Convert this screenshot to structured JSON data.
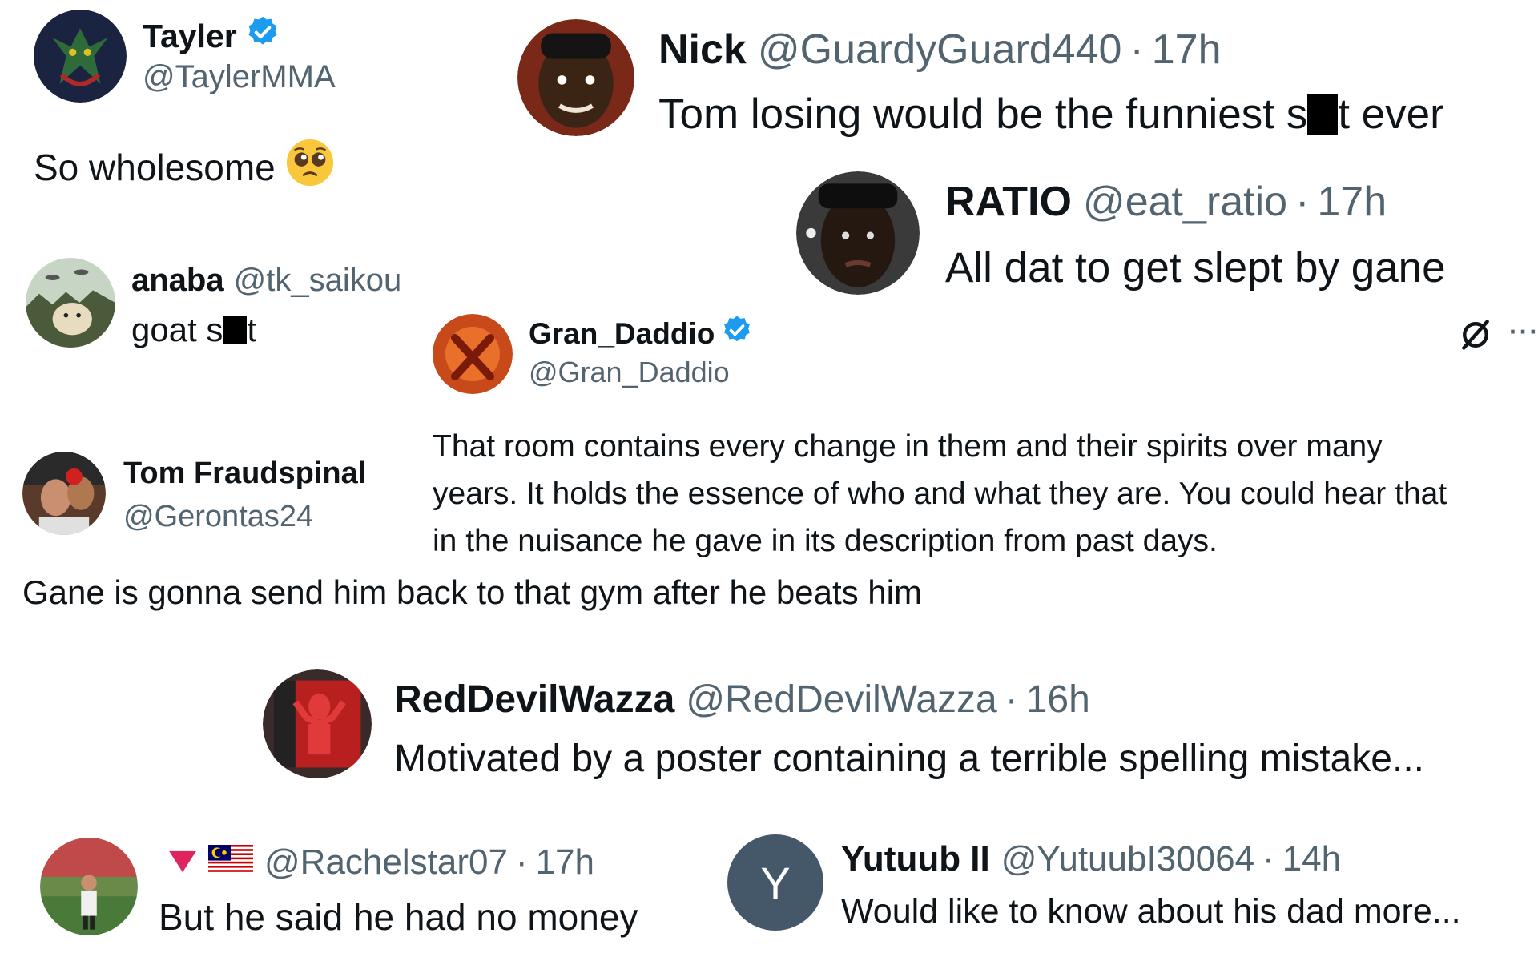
{
  "colors": {
    "text": "#0f1419",
    "muted": "#536471",
    "verified": "#1d9bf0",
    "letter_avatar_bg": "#44586a"
  },
  "tweets": [
    {
      "id": "tayler",
      "name": "Tayler",
      "verified": true,
      "handle": "@TaylerMMA",
      "text": "So wholesome",
      "emoji_icon": "pleading-face-icon"
    },
    {
      "id": "nick",
      "name": "Nick",
      "handle": "@GuardyGuard440",
      "sep": "·",
      "time": "17h",
      "text_before": "Tom losing would be the funniest s",
      "text_after": "t ever"
    },
    {
      "id": "ratio",
      "name": "RATIO",
      "handle": "@eat_ratio",
      "sep": "·",
      "time": "17h",
      "text": "All dat to get slept by gane"
    },
    {
      "id": "anaba",
      "name": "anaba",
      "handle": "@tk_saikou",
      "text_before": "goat s",
      "text_after": "t"
    },
    {
      "id": "gran_daddio",
      "name": "Gran_Daddio",
      "verified": true,
      "handle": "@Gran_Daddio",
      "more": "···",
      "text_lines": [
        "That room contains every change in them and their spirits over many",
        "years. It holds the essence of who and what they are. You could hear that",
        "in the nuisance he gave in its description from past days."
      ]
    },
    {
      "id": "tom",
      "name": "Tom Fraudspinal",
      "handle": "@Gerontas24",
      "text": "Gane is gonna send him back to that gym after he beats him"
    },
    {
      "id": "reddevil",
      "name": "RedDevilWazza",
      "handle": "@RedDevilWazza",
      "sep": "·",
      "time": "16h",
      "text": "Motivated by a poster containing a terrible spelling mistake..."
    },
    {
      "id": "rachel",
      "handle": "@Rachelstar07",
      "sep": "·",
      "time": "17h",
      "text": "But he said he had no money"
    },
    {
      "id": "yutuub",
      "avatar_letter": "Y",
      "name": "Yutuub II",
      "handle": "@YutuubI30064",
      "sep": "·",
      "time": "14h",
      "text": "Would like to know about his dad more..."
    }
  ]
}
